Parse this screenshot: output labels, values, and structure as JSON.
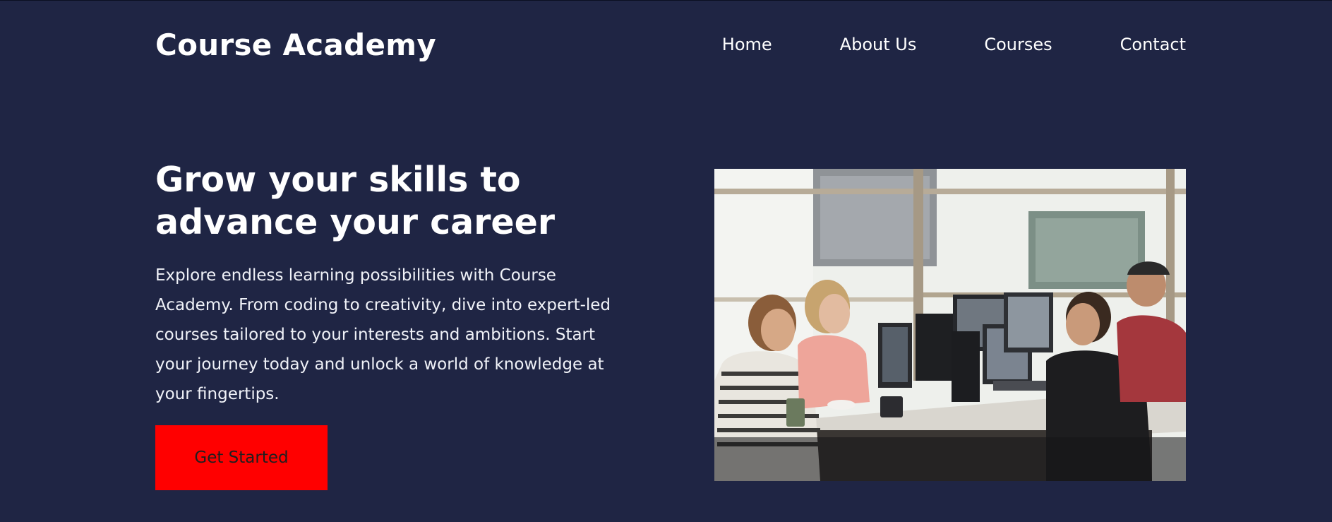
{
  "brand": {
    "name": "Course Academy"
  },
  "nav": {
    "items": [
      {
        "label": "Home"
      },
      {
        "label": "About Us"
      },
      {
        "label": "Courses"
      },
      {
        "label": "Contact"
      }
    ]
  },
  "hero": {
    "title": "Grow your skills to advance your career",
    "description": "Explore endless learning possibilities with Course Academy. From coding to creativity, dive into expert-led courses tailored to your interests and ambitions. Start your journey today and unlock a world of knowledge at your fingertips.",
    "cta_label": "Get Started",
    "image": {
      "subject": "people-working-at-computers-photo"
    }
  },
  "colors": {
    "background": "#1f2544",
    "text": "#ffffff",
    "cta_background": "#ff0000",
    "cta_text": "#1f1f1f"
  }
}
